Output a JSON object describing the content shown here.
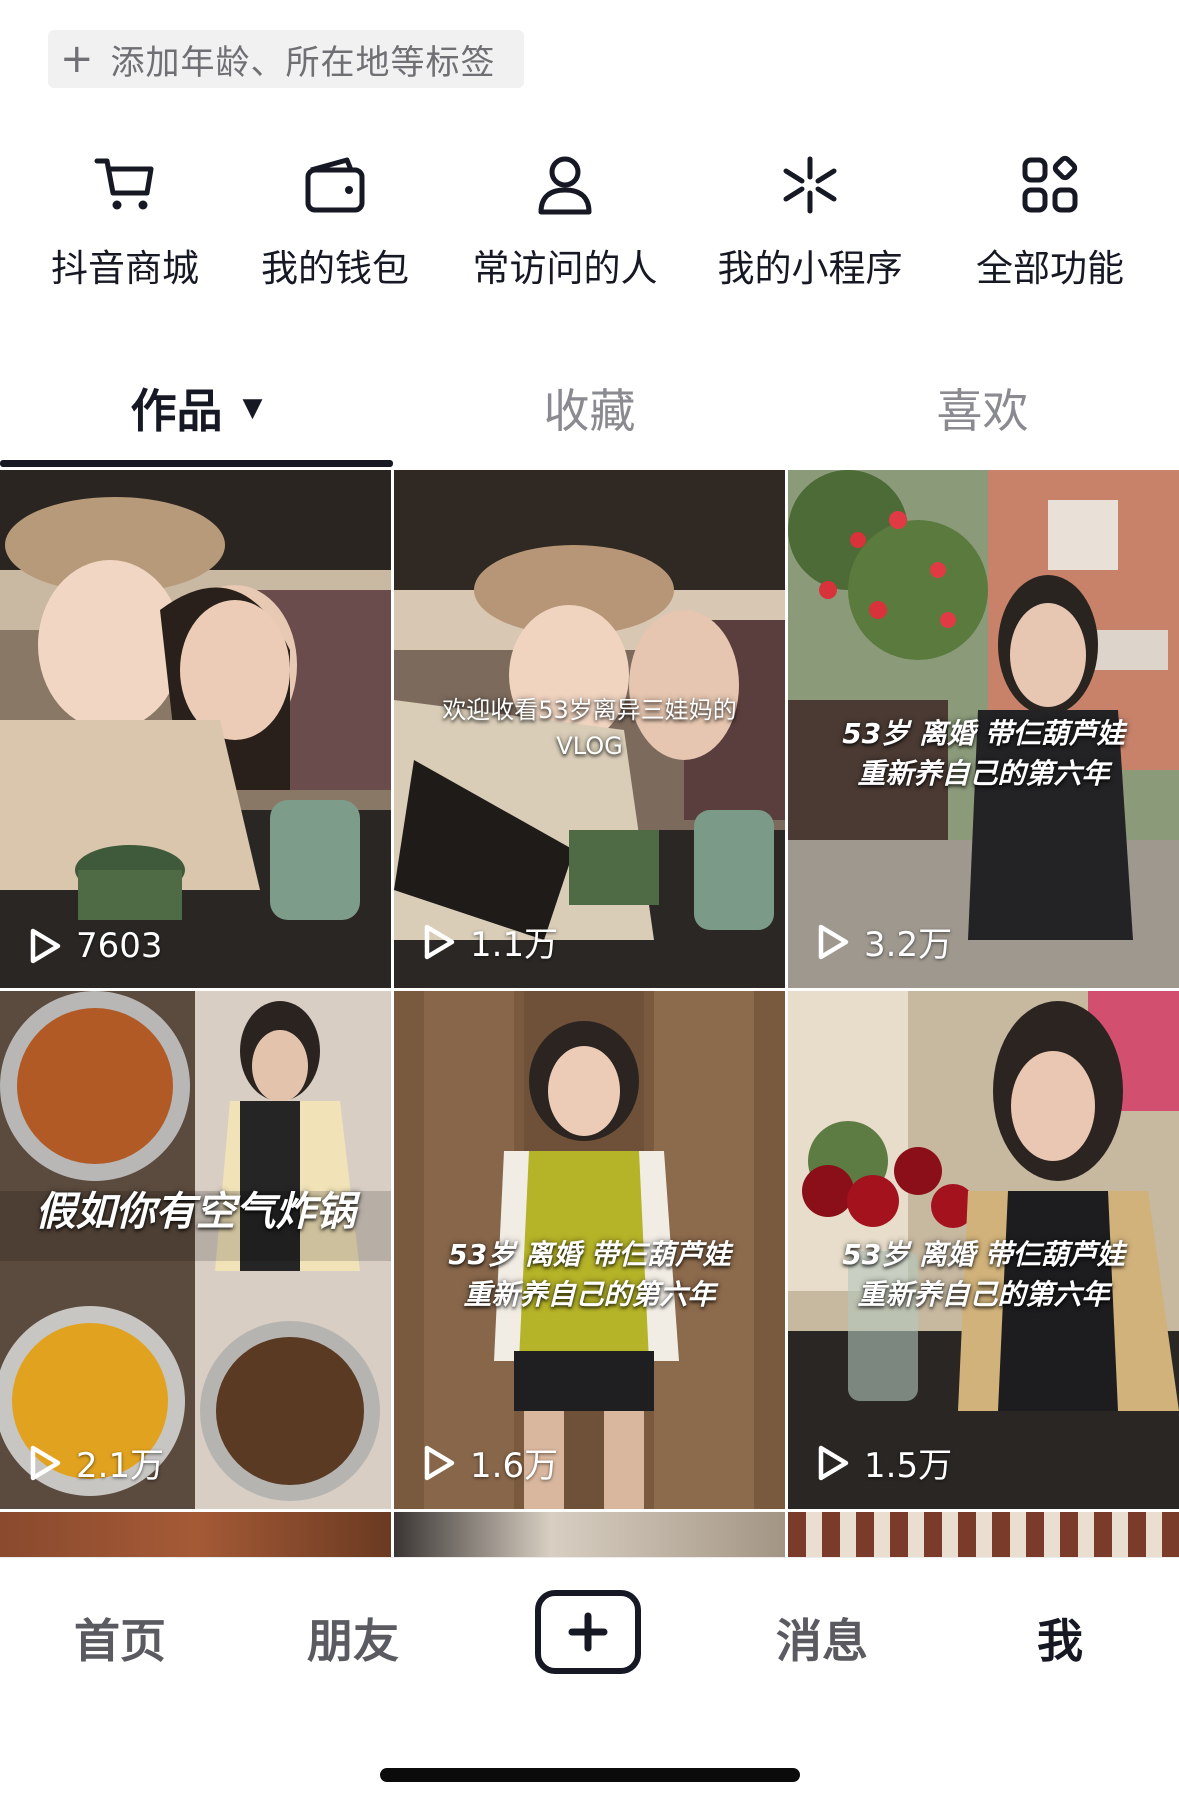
{
  "profile": {
    "tag_prompt": "添加年龄、所在地等标签"
  },
  "quick_actions": [
    {
      "label": "抖音商城",
      "icon": "cart-icon"
    },
    {
      "label": "我的钱包",
      "icon": "wallet-icon"
    },
    {
      "label": "常访问的人",
      "icon": "person-icon"
    },
    {
      "label": "我的小程序",
      "icon": "mini-program-icon"
    },
    {
      "label": "全部功能",
      "icon": "all-functions-icon"
    }
  ],
  "tabs": [
    {
      "label": "作品",
      "active": true
    },
    {
      "label": "收藏",
      "active": false
    },
    {
      "label": "喜欢",
      "active": false
    }
  ],
  "videos": [
    {
      "plays": "7603",
      "overlay": ""
    },
    {
      "plays": "1.1万",
      "overlay_line1": "欢迎收看53岁离异三娃妈的",
      "overlay_line2": "VLOG"
    },
    {
      "plays": "3.2万",
      "overlay_line1": "53岁 离婚 带仨葫芦娃",
      "overlay_line2": "重新养自己的第六年"
    },
    {
      "plays": "2.1万",
      "overlay_line1": "假如你有空气炸锅"
    },
    {
      "plays": "1.6万",
      "overlay_line1": "53岁 离婚 带仨葫芦娃",
      "overlay_line2": "重新养自己的第六年"
    },
    {
      "plays": "1.5万",
      "overlay_line1": "53岁 离婚 带仨葫芦娃",
      "overlay_line2": "重新养自己的第六年"
    }
  ],
  "bottom_nav": [
    {
      "label": "首页",
      "active": false
    },
    {
      "label": "朋友",
      "active": false
    },
    {
      "label": "消息",
      "active": false
    },
    {
      "label": "我",
      "active": true
    }
  ],
  "colors": {
    "text_primary": "#161823",
    "text_secondary": "#8a8b91",
    "chip_bg": "#f1f1f2"
  }
}
